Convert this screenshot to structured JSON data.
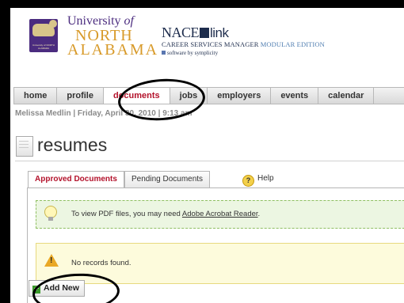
{
  "header": {
    "university_line1": "University",
    "university_of": "of",
    "university_line2": "NORTH",
    "university_line3": "ALABAMA",
    "logo_mini_text": "University of NORTH ALABAMA",
    "nace_brand_a": "NACE",
    "nace_brand_b": "link",
    "nace_sub": "CAREER SERVICES MANAGER",
    "nace_sub_edition": "MODULAR EDITION",
    "nace_powered": "software by symplicity"
  },
  "nav": {
    "items": [
      "home",
      "profile",
      "documents",
      "jobs",
      "employers",
      "events",
      "calendar"
    ],
    "active": "documents"
  },
  "dateline": "Melissa Medlin | Friday, April 30, 2010 | 9:13 am",
  "page_title": "resumes",
  "tabs": {
    "approved": "Approved Documents",
    "pending": "Pending Documents",
    "help": "Help"
  },
  "info_message": {
    "prefix": "To view PDF files, you may need ",
    "link": "Adobe Acrobat Reader",
    "suffix": "."
  },
  "warning_message": "No records found.",
  "add_button": "Add New",
  "colors": {
    "brand_purple": "#4b2c7f",
    "brand_gold": "#d89a29",
    "active_red": "#b3122b",
    "info_bg": "#ecf6e2",
    "warn_bg": "#fdfbdc"
  }
}
